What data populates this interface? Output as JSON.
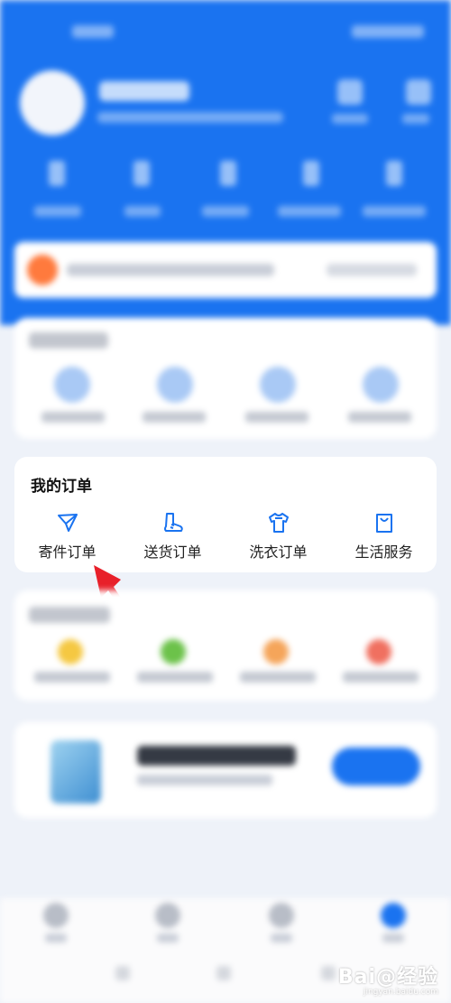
{
  "my_orders": {
    "title": "我的订单",
    "items": [
      {
        "label": "寄件订单",
        "icon": "paper-plane-icon"
      },
      {
        "label": "送货订单",
        "icon": "boot-icon"
      },
      {
        "label": "洗衣订单",
        "icon": "tshirt-icon"
      },
      {
        "label": "生活服务",
        "icon": "shopping-bag-icon"
      }
    ]
  },
  "watermark": {
    "text": "Bai@经验",
    "url": "jingyan.baidu.com"
  },
  "colors": {
    "brand_blue": "#1a73f0",
    "annotation_red": "#e8202a"
  }
}
